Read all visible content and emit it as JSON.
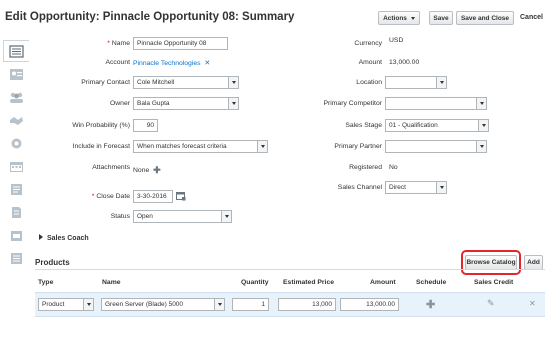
{
  "header": {
    "title": "Edit Opportunity: Pinnacle Opportunity 08: Summary",
    "actions_label": "Actions",
    "save_label": "Save",
    "save_close_label": "Save and Close",
    "cancel_label": "Cancel"
  },
  "sidebar": {
    "items": [
      {
        "icon": "summary-icon",
        "active": true
      },
      {
        "icon": "profile-card-icon"
      },
      {
        "icon": "team-icon"
      },
      {
        "icon": "handshake-icon"
      },
      {
        "icon": "gear-icon"
      },
      {
        "icon": "calendar-icon"
      },
      {
        "icon": "notes-icon"
      },
      {
        "icon": "document-icon"
      },
      {
        "icon": "attachment-icon"
      },
      {
        "icon": "list-icon"
      }
    ]
  },
  "form_left": {
    "name_label": "Name",
    "name_value": "Pinnacle Opportunity 08",
    "account_label": "Account",
    "account_value": "Pinnacle Technologies",
    "primary_contact_label": "Primary Contact",
    "primary_contact_value": "Cole Mitchell",
    "owner_label": "Owner",
    "owner_value": "Bala Gupta",
    "win_probability_label": "Win Probability (%)",
    "win_probability_value": "90",
    "include_forecast_label": "Include in Forecast",
    "include_forecast_value": "When matches forecast criteria",
    "attachments_label": "Attachments",
    "attachments_value": "None",
    "close_date_label": "Close Date",
    "close_date_value": "3-30-2016",
    "status_label": "Status",
    "status_value": "Open"
  },
  "form_right": {
    "currency_label": "Currency",
    "currency_value": "USD",
    "amount_label": "Amount",
    "amount_value": "13,000.00",
    "location_label": "Location",
    "location_value": "",
    "primary_competitor_label": "Primary Competitor",
    "primary_competitor_value": "",
    "sales_stage_label": "Sales Stage",
    "sales_stage_value": "01 - Qualification",
    "primary_partner_label": "Primary Partner",
    "primary_partner_value": "",
    "registered_label": "Registered",
    "registered_value": "No",
    "sales_channel_label": "Sales Channel",
    "sales_channel_value": "Direct"
  },
  "sales_coach": {
    "label": "Sales Coach"
  },
  "products": {
    "title": "Products",
    "browse_catalog_label": "Browse Catalog",
    "add_label": "Add",
    "columns": [
      "Type",
      "Name",
      "Quantity",
      "Estimated Price",
      "Amount",
      "Schedule",
      "Sales Credit"
    ],
    "rows": [
      {
        "type": "Product",
        "name": "Green Server (Blade) 5000",
        "quantity": "1",
        "estimated_price": "13,000",
        "amount": "13,000.00"
      }
    ]
  },
  "colors": {
    "accent": "#0572ce",
    "highlight": "#e3262e",
    "row_bg": "#e8f2fb"
  }
}
